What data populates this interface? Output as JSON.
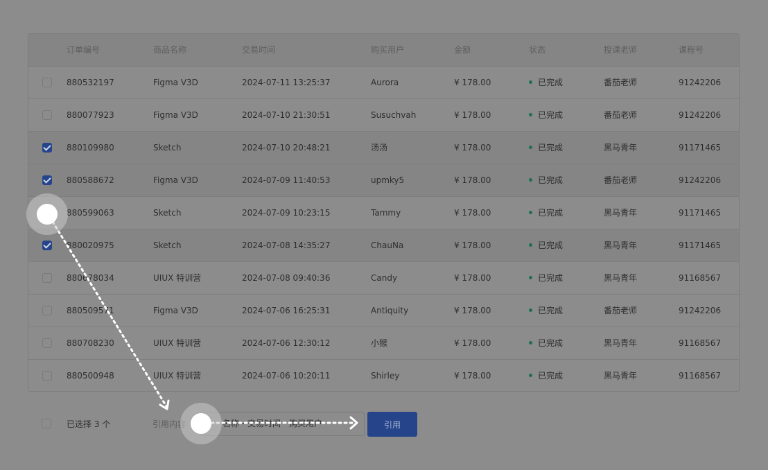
{
  "table": {
    "headers": {
      "order_no": "订单编号",
      "product": "商品名称",
      "time": "交易时间",
      "user": "购买用户",
      "amount": "金额",
      "status": "状态",
      "teacher": "授课老师",
      "course": "课程号"
    },
    "rows": [
      {
        "checked": false,
        "order_no": "880532197",
        "product": "Figma V3D",
        "time": "2024-07-11 13:25:37",
        "user": "Aurora",
        "amount": "¥ 178.00",
        "status": "已完成",
        "teacher": "番茄老师",
        "course": "91242206"
      },
      {
        "checked": false,
        "order_no": "880077923",
        "product": "Figma V3D",
        "time": "2024-07-10 21:30:51",
        "user": "Susuchvah",
        "amount": "¥ 178.00",
        "status": "已完成",
        "teacher": "番茄老师",
        "course": "91242206"
      },
      {
        "checked": true,
        "order_no": "880109980",
        "product": "Sketch",
        "time": "2024-07-10 20:48:21",
        "user": "汤汤",
        "amount": "¥ 178.00",
        "status": "已完成",
        "teacher": "黑马青年",
        "course": "91171465"
      },
      {
        "checked": true,
        "order_no": "880588672",
        "product": "Figma V3D",
        "time": "2024-07-09 11:40:53",
        "user": "upmky5",
        "amount": "¥ 178.00",
        "status": "已完成",
        "teacher": "番茄老师",
        "course": "91242206"
      },
      {
        "checked": false,
        "order_no": "880599063",
        "product": "Sketch",
        "time": "2024-07-09 10:23:15",
        "user": "Tammy",
        "amount": "¥ 178.00",
        "status": "已完成",
        "teacher": "黑马青年",
        "course": "91171465"
      },
      {
        "checked": true,
        "order_no": "880020975",
        "product": "Sketch",
        "time": "2024-07-08 14:35:27",
        "user": "ChauNa",
        "amount": "¥ 178.00",
        "status": "已完成",
        "teacher": "黑马青年",
        "course": "91171465"
      },
      {
        "checked": false,
        "order_no": "880678034",
        "product": "UIUX 特训营",
        "time": "2024-07-08 09:40:36",
        "user": "Candy",
        "amount": "¥ 178.00",
        "status": "已完成",
        "teacher": "黑马青年",
        "course": "91168567"
      },
      {
        "checked": false,
        "order_no": "880509571",
        "product": "Figma V3D",
        "time": "2024-07-06 16:25:31",
        "user": "Antiquity",
        "amount": "¥ 178.00",
        "status": "已完成",
        "teacher": "番茄老师",
        "course": "91242206"
      },
      {
        "checked": false,
        "order_no": "880708230",
        "product": "UIUX 特训营",
        "time": "2024-07-06 12:30:12",
        "user": "小猴",
        "amount": "¥ 178.00",
        "status": "已完成",
        "teacher": "黑马青年",
        "course": "91168567"
      },
      {
        "checked": false,
        "order_no": "880500948",
        "product": "UIUX 特训营",
        "time": "2024-07-06 10:20:11",
        "user": "Shirley",
        "amount": "¥ 178.00",
        "status": "已完成",
        "teacher": "黑马青年",
        "course": "91168567"
      }
    ]
  },
  "footer": {
    "selected_text": "已选择 3 个",
    "quote_label": "引用内容",
    "quote_value": "名称・交易时间・购买用户",
    "quote_button": "引用"
  },
  "colors": {
    "accent": "#25448a",
    "status_done": "#1f6e53"
  }
}
